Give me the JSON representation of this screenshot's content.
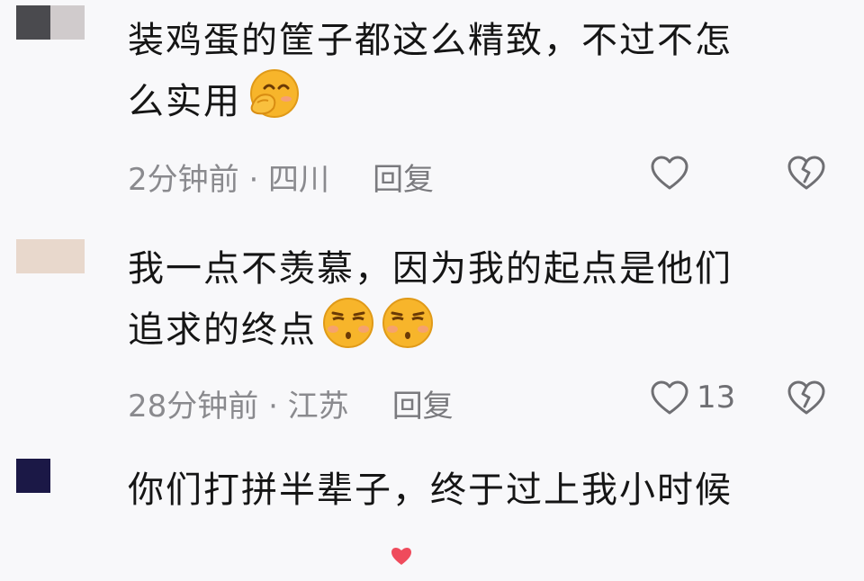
{
  "comments": [
    {
      "avatar_colors": [
        "#4a4a4e",
        "#d0cbcc"
      ],
      "text_line1": "装鸡蛋的筐子都这么精致，不过不怎",
      "text_line2": "么实用",
      "emoji": [
        "covering-mouth-laugh-emoji"
      ],
      "time": "2分钟前 · 四川",
      "reply_label": "回复",
      "like_count": ""
    },
    {
      "avatar_colors": [
        "#e8d8cc",
        "#e8d8cc"
      ],
      "text_line1": "我一点不羡慕，因为我的起点是他们",
      "text_line2": "追求的终点",
      "emoji": [
        "unamused-face-emoji",
        "unamused-face-emoji"
      ],
      "time": "28分钟前 · 江苏",
      "reply_label": "回复",
      "like_count": "13"
    },
    {
      "avatar_colors": [
        "#1b1846",
        "#f8f8fa"
      ],
      "text_line1": "你们打拼半辈子，终于过上我小时候",
      "text_line2": "",
      "emoji": [],
      "time": "",
      "reply_label": "",
      "like_count": ""
    }
  ],
  "colors": {
    "background": "#f8f8fa",
    "meta_text": "#8a8a8e",
    "emoji_yellow": "#f7b52b"
  }
}
